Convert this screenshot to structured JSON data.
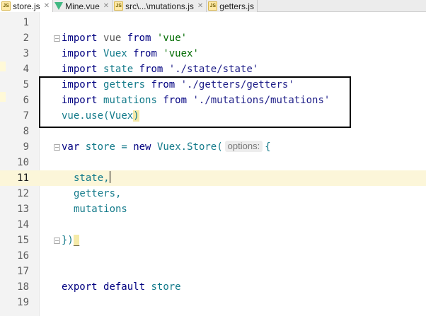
{
  "tabs": [
    {
      "label": "store.js",
      "icon": "js-file-icon",
      "active": true
    },
    {
      "label": "Mine.vue",
      "icon": "vue-file-icon",
      "active": false
    },
    {
      "label": "src\\...\\mutations.js",
      "icon": "js-file-icon",
      "active": false
    },
    {
      "label": "getters.js",
      "icon": "js-file-icon",
      "active": false
    }
  ],
  "editor": {
    "current_line": 11,
    "lines": {
      "l1": {
        "num": "1"
      },
      "l2": {
        "num": "2",
        "kw": "import",
        "name": "vue",
        "from": "from",
        "str": "'vue'"
      },
      "l3": {
        "num": "3",
        "kw": "import",
        "name": "Vuex",
        "from": "from",
        "str": "'vuex'"
      },
      "l4": {
        "num": "4",
        "kw": "import",
        "name": "state",
        "from": "from",
        "str": "'./state/state'"
      },
      "l5": {
        "num": "5",
        "kw": "import",
        "name": "getters",
        "from": "from",
        "str": "'./getters/getters'"
      },
      "l6": {
        "num": "6",
        "kw": "import",
        "name": "mutations",
        "from": "from",
        "str": "'./mutations/mutations'"
      },
      "l7": {
        "num": "7",
        "obj": "vue",
        "dot": ".",
        "method": "use",
        "open": "(",
        "arg": "Vuex",
        "close": ")"
      },
      "l8": {
        "num": "8"
      },
      "l9": {
        "num": "9",
        "kw": "var",
        "name": "store",
        "eq": "=",
        "new": "new",
        "cls": "Vuex.Store",
        "open": "(",
        "hint": "options:",
        "brace": "{"
      },
      "l10": {
        "num": "10"
      },
      "l11": {
        "num": "11",
        "prop": "state",
        "comma": ","
      },
      "l12": {
        "num": "12",
        "prop": "getters",
        "comma": ","
      },
      "l13": {
        "num": "13",
        "prop": "mutations"
      },
      "l14": {
        "num": "14"
      },
      "l15": {
        "num": "15",
        "close": "})",
        "tail": "_"
      },
      "l16": {
        "num": "16"
      },
      "l17": {
        "num": "17"
      },
      "l18": {
        "num": "18",
        "kw": "export",
        "kw2": "default",
        "name": "store"
      },
      "l19": {
        "num": "19"
      }
    }
  }
}
